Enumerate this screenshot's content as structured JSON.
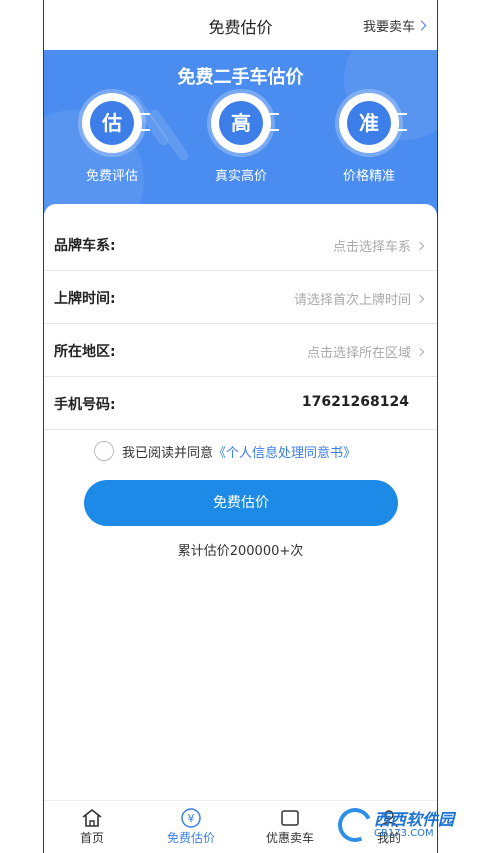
{
  "header": {
    "title": "免费估价",
    "sell_link": "我要卖车"
  },
  "banner": {
    "title": "免费二手车估价",
    "features": [
      {
        "glyph": "估",
        "label": "免费评估"
      },
      {
        "glyph": "高",
        "label": "真实高价"
      },
      {
        "glyph": "准",
        "label": "价格精准"
      }
    ]
  },
  "form": {
    "rows": [
      {
        "label": "品牌车系:",
        "value": "点击选择车系"
      },
      {
        "label": "上牌时间:",
        "value": "请选择首次上牌时间"
      },
      {
        "label": "所在地区:",
        "value": "点击选择所在区域"
      },
      {
        "label": "手机号码:",
        "value": "17621268124"
      }
    ],
    "agree_text": "我已阅读并同意",
    "agree_link": "《个人信息处理同意书》",
    "submit_label": "免费估价",
    "count_text": "累计估价200000+次"
  },
  "tabs": [
    {
      "label": "首页",
      "icon": "home-icon"
    },
    {
      "label": "免费估价",
      "icon": "yen-icon"
    },
    {
      "label": "优惠卖车",
      "icon": "tag-icon"
    },
    {
      "label": "我的",
      "icon": "user-icon"
    }
  ],
  "watermark": {
    "name": "西西软件园",
    "domain": "CR173.COM"
  },
  "colors": {
    "primary": "#1e8ae8",
    "banner": "#4a8cf0",
    "link": "#3b7fe8"
  }
}
